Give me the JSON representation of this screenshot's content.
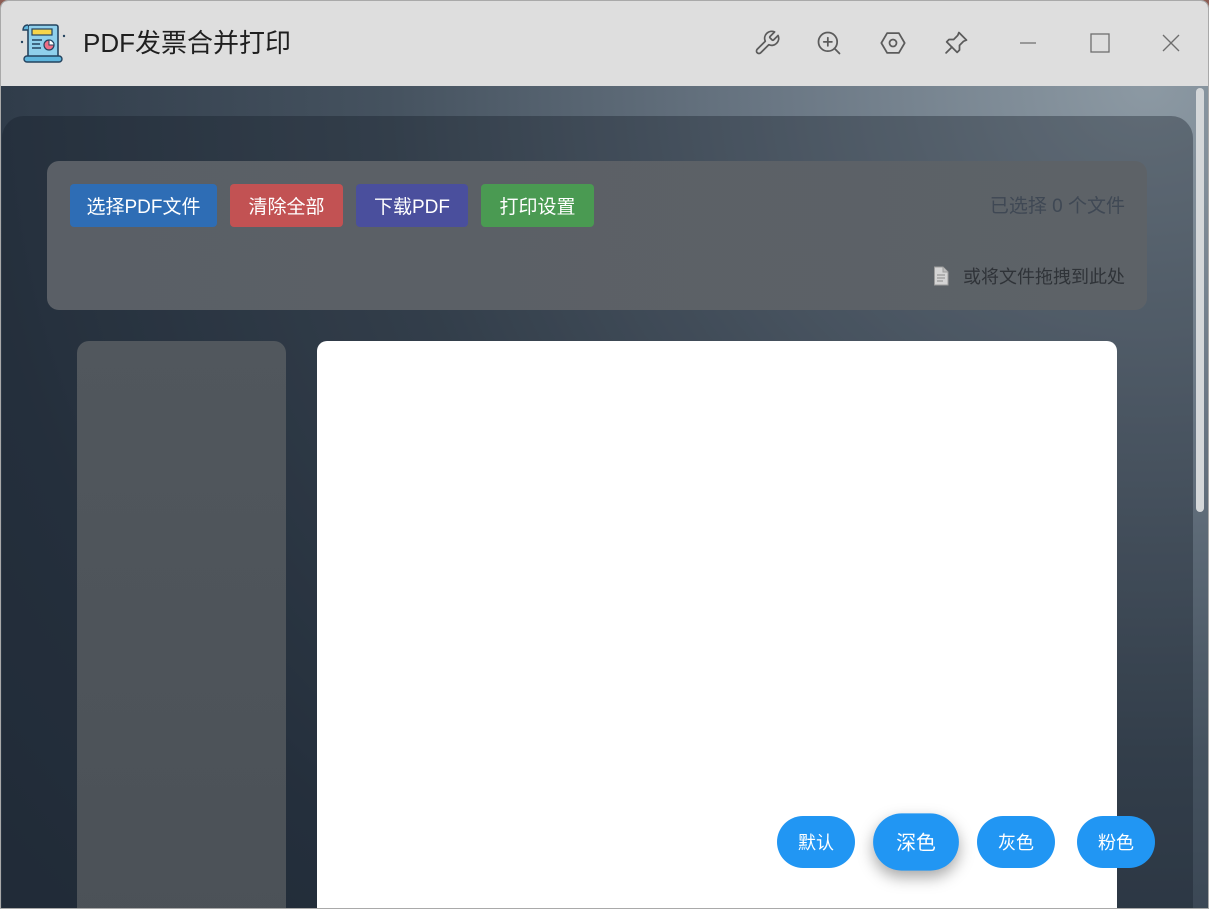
{
  "window": {
    "title": "PDF发票合并打印",
    "app_icon": "invoice-scroll-icon",
    "tools": [
      "wrench-icon",
      "zoom-in-icon",
      "hexagon-settings-icon",
      "pin-icon"
    ],
    "controls": [
      "minimize-icon",
      "maximize-icon",
      "close-icon"
    ]
  },
  "toolbar": {
    "buttons": [
      {
        "label": "选择PDF文件",
        "color": "#2e6db5"
      },
      {
        "label": "清除全部",
        "color": "#c25253"
      },
      {
        "label": "下载PDF",
        "color": "#4a4f9d"
      },
      {
        "label": "打印设置",
        "color": "#4a9a52"
      }
    ],
    "status_text": "已选择 0 个文件",
    "drop_hint_icon": "document-icon",
    "drop_hint": "或将文件拖拽到此处"
  },
  "theme_switcher": {
    "accent": "#2196f3",
    "options": [
      {
        "label": "默认",
        "active": false
      },
      {
        "label": "深色",
        "active": true
      },
      {
        "label": "灰色",
        "active": false
      },
      {
        "label": "粉色",
        "active": false
      }
    ]
  }
}
